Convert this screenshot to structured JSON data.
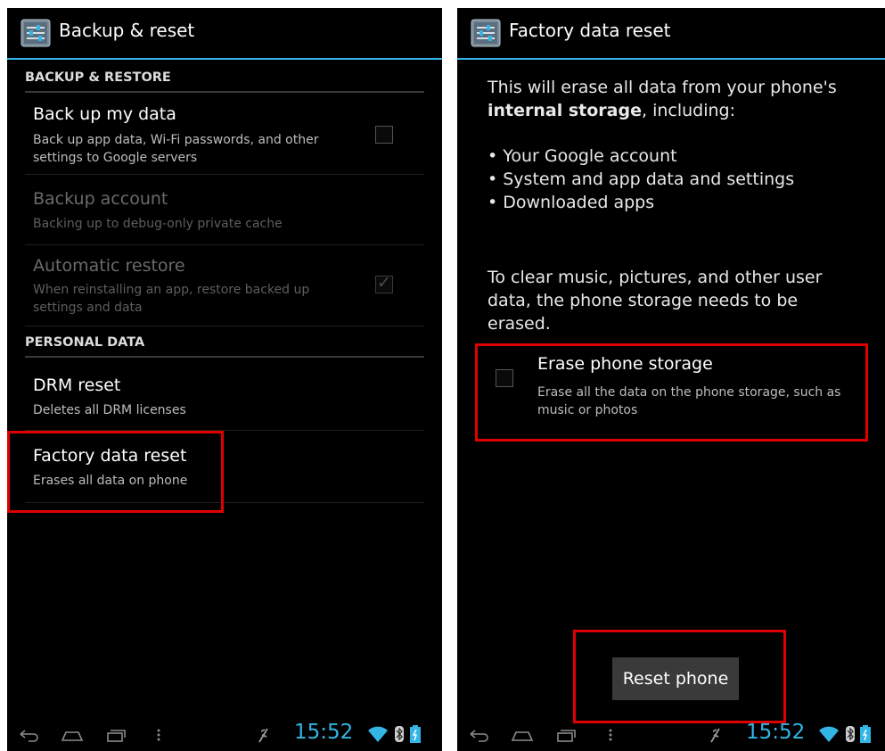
{
  "left_screen": {
    "title": "Backup & reset",
    "sections": {
      "backup_restore": "BACKUP & RESTORE",
      "personal_data": "PERSONAL DATA"
    },
    "items": [
      {
        "title": "Back up my data",
        "summary": "Back up app data, Wi-Fi passwords, and other settings to Google servers",
        "checked": false,
        "enabled": true
      },
      {
        "title": "Backup account",
        "summary": "Backing up to debug-only private cache",
        "enabled": false
      },
      {
        "title": "Automatic restore",
        "summary": "When reinstalling an app, restore backed up settings and data",
        "checked": true,
        "enabled": false
      },
      {
        "title": "DRM reset",
        "summary": "Deletes all DRM licenses"
      },
      {
        "title": "Factory data reset",
        "summary": "Erases all data on phone",
        "highlighted": true
      }
    ],
    "status": {
      "time": "15:52"
    }
  },
  "right_screen": {
    "title": "Factory data reset",
    "intro_text": "This will erase all data from your phone's",
    "intro_bold": "internal storage",
    "intro_end": ", including:",
    "bullets": [
      "• Your Google account",
      "• System and app data and settings",
      "• Downloaded apps"
    ],
    "clear_text": "To clear music, pictures, and other user data, the phone storage needs to be erased.",
    "erase_option": {
      "title": "Erase phone storage",
      "summary": "Erase all the data on the phone storage, such as music or photos",
      "checked": false
    },
    "reset_button": "Reset phone",
    "status": {
      "time": "15:52"
    }
  },
  "colors": {
    "accent": "#33b5e5",
    "highlight": "#e00000",
    "background": "#000000"
  },
  "icons": [
    "settings-app-icon",
    "back-icon",
    "home-icon",
    "recents-icon",
    "menu-icon",
    "usb-debug-icon",
    "wifi-icon",
    "bluetooth-icon",
    "battery-icon"
  ]
}
